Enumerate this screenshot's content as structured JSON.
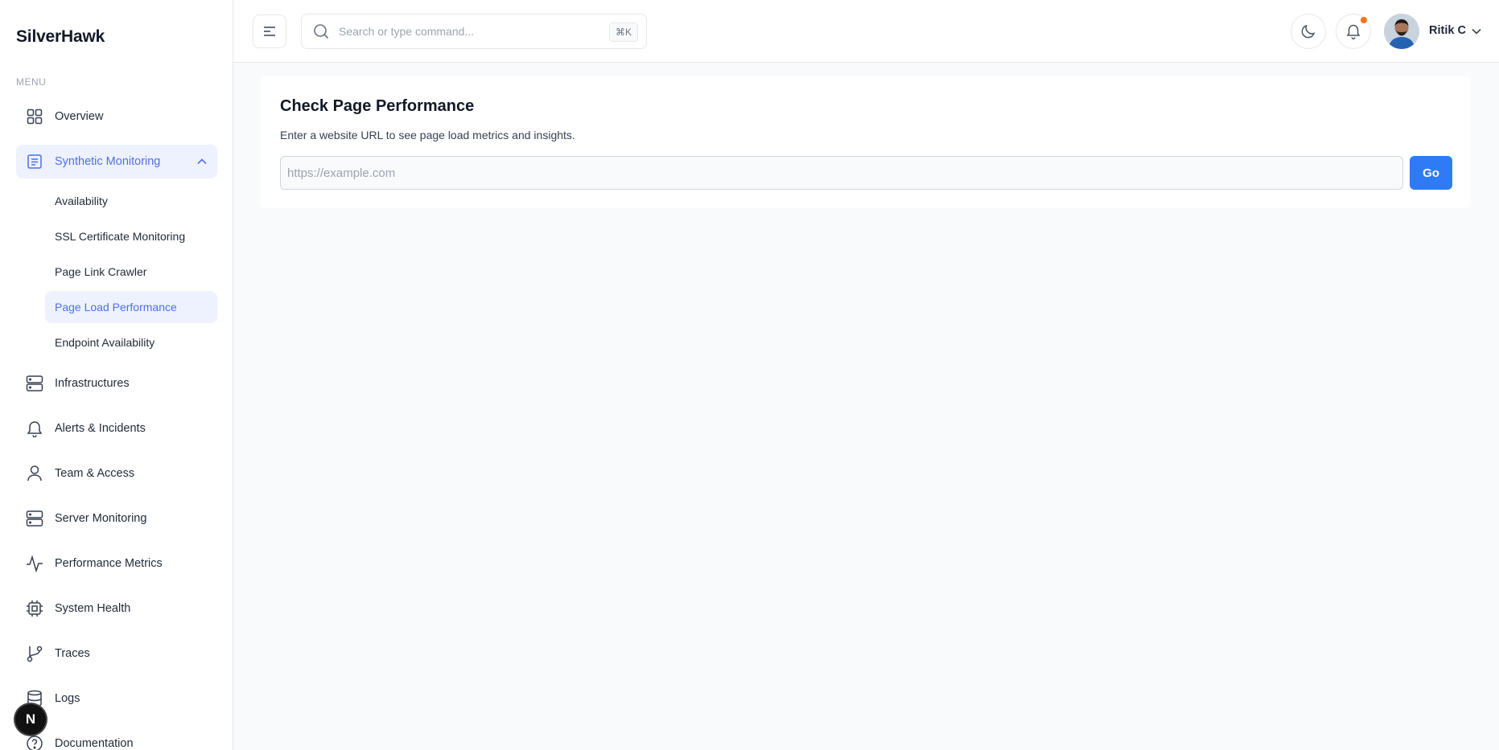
{
  "brand": "SilverHawk",
  "menu_label": "MENU",
  "nav": {
    "overview": "Overview",
    "synthetic": "Synthetic Monitoring",
    "sub": {
      "availability": "Availability",
      "ssl": "SSL Certificate Monitoring",
      "crawler": "Page Link Crawler",
      "page_load": "Page Load Performance",
      "endpoint": "Endpoint Availability"
    },
    "infrastructures": "Infrastructures",
    "alerts": "Alerts & Incidents",
    "team": "Team & Access",
    "server": "Server Monitoring",
    "performance": "Performance Metrics",
    "health": "System Health",
    "traces": "Traces",
    "logs": "Logs",
    "documentation": "Documentation"
  },
  "header": {
    "search_placeholder": "Search or type command...",
    "search_shortcut": "⌘K",
    "user_name": "Ritik C"
  },
  "badge": "N",
  "main": {
    "title": "Check Page Performance",
    "subtitle": "Enter a website URL to see page load metrics and insights.",
    "url_placeholder": "https://example.com",
    "go_label": "Go"
  },
  "colors": {
    "accent": "#4f6ee8",
    "button": "#2f7bf5",
    "notification": "#f97316"
  }
}
